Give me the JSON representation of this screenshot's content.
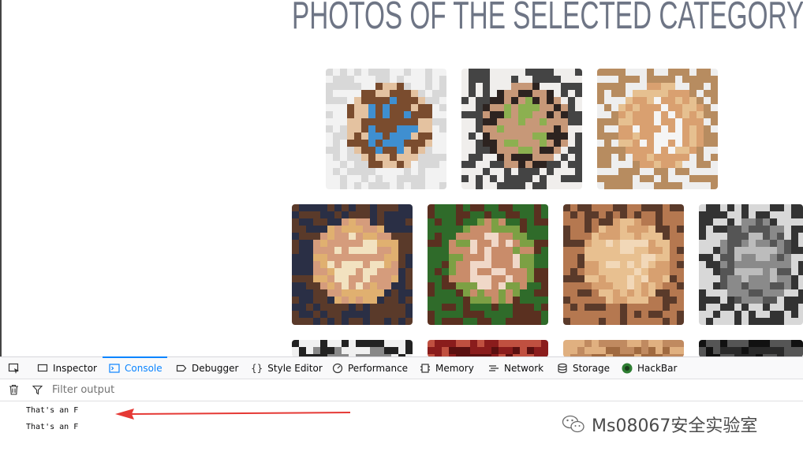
{
  "page": {
    "title": "PHOTOS OF THE SELECTED CATEGORY",
    "photos": [
      {
        "name": "girl-reading-book",
        "palette": [
          "#d8d8d8",
          "#e4c2a0",
          "#7a4c2e",
          "#3f8fd0",
          "#f2f2f2"
        ]
      },
      {
        "name": "woman-with-camera",
        "palette": [
          "#f0eeec",
          "#2d2320",
          "#c79878",
          "#8cb050",
          "#444444"
        ]
      },
      {
        "name": "woman-with-cup",
        "palette": [
          "#eeeeee",
          "#e6c090",
          "#d9a070",
          "#f5f5f5",
          "#b78c60"
        ]
      },
      {
        "name": "blonde-woman-closeup",
        "palette": [
          "#2a2f45",
          "#e0b070",
          "#d59c7c",
          "#f2e2c0",
          "#5a3a2a"
        ]
      },
      {
        "name": "woman-on-phone-outdoors",
        "palette": [
          "#2f6b2a",
          "#7ca044",
          "#c98c6a",
          "#f0d8c8",
          "#5a3020"
        ]
      },
      {
        "name": "woman-on-phone-smiling",
        "palette": [
          "#5a3a2a",
          "#d7a070",
          "#e8c090",
          "#f2d8b8",
          "#b57850"
        ]
      },
      {
        "name": "man-in-cap",
        "palette": [
          "#d8d8d8",
          "#555555",
          "#8a8a8a",
          "#bcbcbc",
          "#333333"
        ]
      }
    ],
    "row3": [
      {
        "name": "photo-row3-1",
        "palette": [
          "#f0f0f0",
          "#222222",
          "#888888"
        ]
      },
      {
        "name": "photo-row3-2",
        "palette": [
          "#8a1c1c",
          "#c05040",
          "#5a1010"
        ]
      },
      {
        "name": "photo-row3-3",
        "palette": [
          "#c08a60",
          "#e0b080",
          "#a06a40"
        ]
      },
      {
        "name": "photo-row3-4",
        "palette": [
          "#111111",
          "#555555",
          "#2a2a2a"
        ]
      }
    ]
  },
  "devtools": {
    "tabs": [
      {
        "label": "Inspector",
        "icon": "inspector-icon"
      },
      {
        "label": "Console",
        "icon": "console-icon",
        "selected": true
      },
      {
        "label": "Debugger",
        "icon": "debugger-icon"
      },
      {
        "label": "Style Editor",
        "icon": "style-editor-icon"
      },
      {
        "label": "Performance",
        "icon": "performance-icon"
      },
      {
        "label": "Memory",
        "icon": "memory-icon"
      },
      {
        "label": "Network",
        "icon": "network-icon"
      },
      {
        "label": "Storage",
        "icon": "storage-icon"
      },
      {
        "label": "HackBar",
        "icon": "hackbar-icon"
      }
    ],
    "filter_placeholder": "Filter output",
    "console_lines": [
      "That's an F",
      "That's an F"
    ]
  },
  "watermark": {
    "text": "Ms08067安全实验室",
    "icon": "wechat-icon"
  },
  "colors": {
    "accent": "#0a84ff",
    "arrow": "#e53935",
    "title": "#6e7585"
  }
}
